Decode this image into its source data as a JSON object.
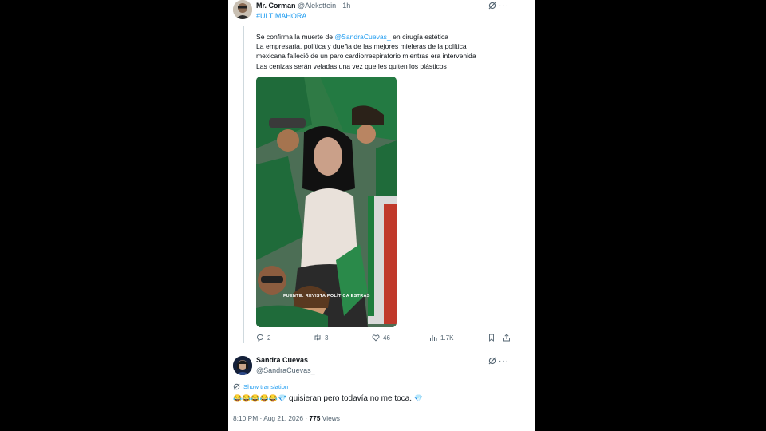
{
  "tweet": {
    "author_name": "Mr. Corman",
    "author_handle": "@Aleksttein",
    "separator": "·",
    "time": "1h",
    "hashtag": "#ULTIMAHORA",
    "line1_prefix": "Se confirma la muerte de",
    "mention": "@SandraCuevas_",
    "line1_suffix": "en cirugía estética",
    "line2": "La empresaria, política y dueña de las mejores mieleras de la política",
    "line3": "mexicana falleció de un paro cardiorrespiratorio mientras era intervenida",
    "line4": "Las cenizas serán veladas una vez que les quiten los plásticos",
    "watermark": "FUENTE: REVISTA POLÍTICA ESTRAS",
    "replies": "2",
    "retweets": "3",
    "likes": "46",
    "views": "1.7K",
    "more": "···"
  },
  "reply": {
    "author_name": "Sandra Cuevas",
    "author_handle": "@SandraCuevas_",
    "translate_label": "Show translation",
    "emojis": "😂😂😂😂😂💎",
    "text": "quisieran pero todavía no me toca.",
    "trailing_emoji": "💎",
    "time": "8:10 PM",
    "date": "Aug 21, 2026",
    "views_count": "775",
    "views_label": "Views",
    "more": "···"
  },
  "colors": {
    "accent": "#1d9bf0",
    "muted": "#536471",
    "text": "#0f1419",
    "jersey_green": "#1f6b3a"
  }
}
